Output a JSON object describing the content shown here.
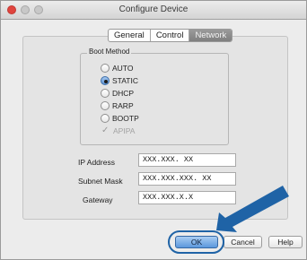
{
  "window": {
    "title": "Configure Device"
  },
  "tabs": [
    {
      "label": "General",
      "active": false
    },
    {
      "label": "Control",
      "active": false
    },
    {
      "label": "Network",
      "active": true
    }
  ],
  "boot_method": {
    "legend": "Boot Method",
    "options": [
      {
        "label": "AUTO",
        "selected": false
      },
      {
        "label": "STATIC",
        "selected": true
      },
      {
        "label": "DHCP",
        "selected": false
      },
      {
        "label": "RARP",
        "selected": false
      },
      {
        "label": "BOOTP",
        "selected": false
      }
    ],
    "apipa": {
      "label": "APIPA",
      "checked": true,
      "disabled": true
    }
  },
  "fields": {
    "ip_address": {
      "label": "IP Address",
      "value": "XXX.XXX. XX"
    },
    "subnet_mask": {
      "label": "Subnet Mask",
      "value": "XXX.XXX.XXX. XX"
    },
    "gateway": {
      "label": "Gateway",
      "value": "XXX.XXX.X.X"
    }
  },
  "buttons": {
    "ok": "OK",
    "cancel": "Cancel",
    "help": "Help"
  },
  "colors": {
    "accent": "#5b97dc",
    "callout": "#1f63a6",
    "close": "#e0443e"
  },
  "icons": {
    "apipa_check": "checkmark-icon",
    "callout": "arrow-pointer-icon"
  }
}
